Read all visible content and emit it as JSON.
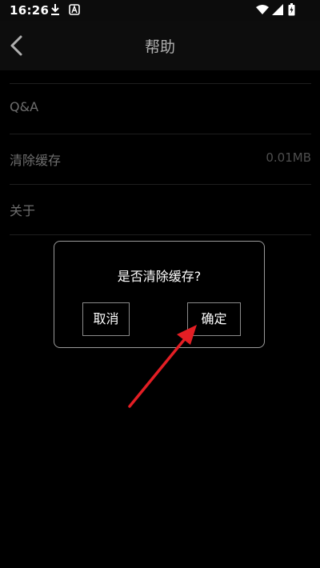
{
  "status_bar": {
    "time": "16:26",
    "icons": [
      "download-icon",
      "a-icon",
      "wifi-icon",
      "signal-icon",
      "battery-icon"
    ]
  },
  "header": {
    "title": "帮助",
    "back_icon": "chevron-left-icon"
  },
  "list": {
    "items": [
      {
        "label": "Q&A",
        "value": ""
      },
      {
        "label": "清除缓存",
        "value": "0.01MB"
      },
      {
        "label": "关于",
        "value": ""
      }
    ]
  },
  "dialog": {
    "message": "是否清除缓存?",
    "cancel_label": "取消",
    "confirm_label": "确定"
  },
  "colors": {
    "background": "#000000",
    "annotation_arrow": "#e31e24"
  }
}
